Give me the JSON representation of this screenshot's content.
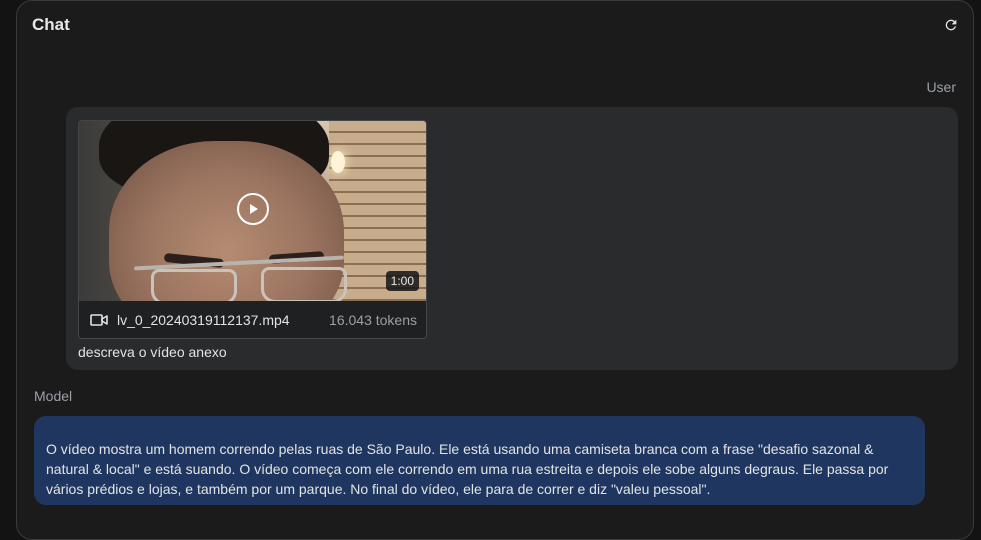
{
  "panel": {
    "title": "Chat",
    "refresh_icon": "refresh-icon"
  },
  "user_message": {
    "role": "User",
    "attachment": {
      "duration": "1:00",
      "file_icon": "video-icon",
      "file_name": "lv_0_20240319112137.mp4",
      "tokens": "16.043 tokens"
    },
    "text": "descreva o vídeo anexo"
  },
  "model_message": {
    "role": "Model",
    "text": "O vídeo mostra um homem correndo pelas ruas de São Paulo. Ele está usando uma camiseta branca com a frase \"desafio sazonal & natural & local\" e está suando. O vídeo começa com ele correndo em uma rua estreita e depois ele sobe alguns degraus. Ele passa por vários prédios e lojas, e também por um parque. No final do vídeo, ele para de correr e diz \"valeu pessoal\"."
  },
  "colors": {
    "background": "#131314",
    "panel": "#1b1b1c",
    "user_bubble": "#2a2b2d",
    "model_bubble": "#1f3760",
    "muted_text": "#9aa0a6"
  }
}
